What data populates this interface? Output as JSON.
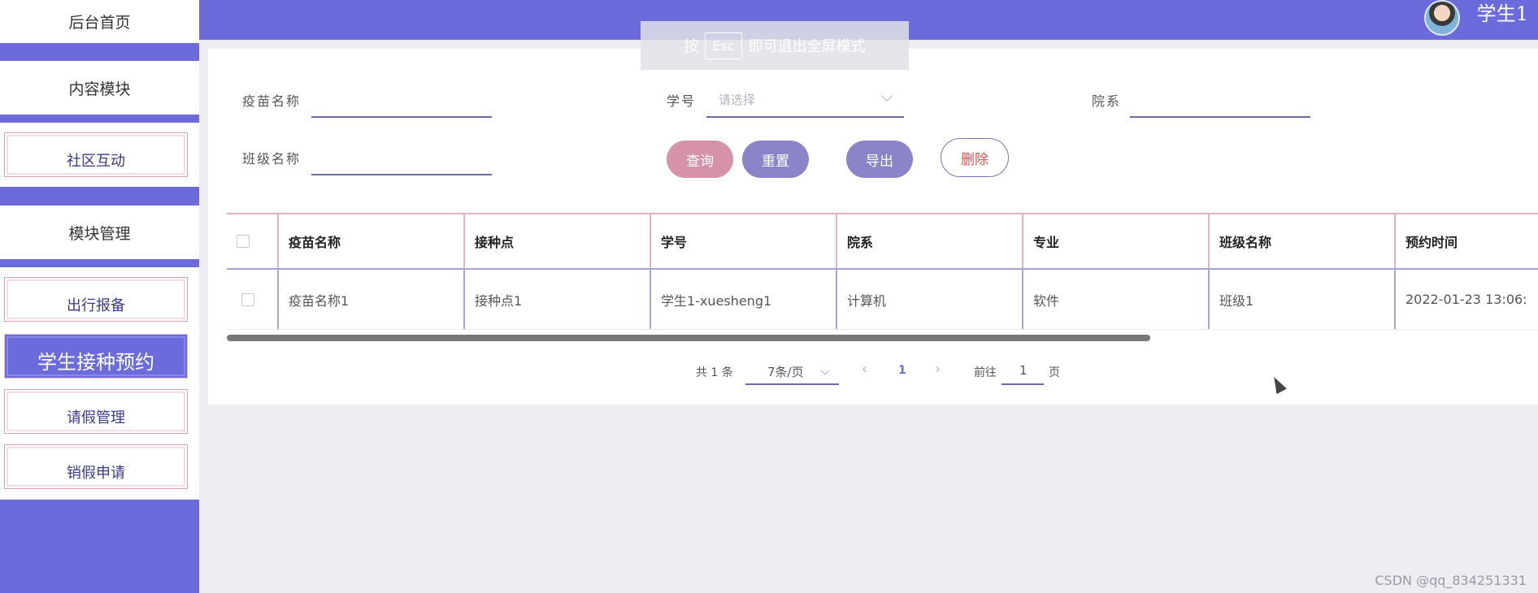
{
  "sidebar": {
    "home": "后台首页",
    "content_module": "内容模块",
    "community": "社区互动",
    "module_manage": "模块管理",
    "items": [
      "出行报备",
      "学生接种预约",
      "请假管理",
      "销假申请"
    ]
  },
  "header": {
    "username": "学生1"
  },
  "toast": {
    "prefix": "按",
    "key": "Esc",
    "suffix": "即可退出全屏模式"
  },
  "search": {
    "vaccine_label": "疫苗名称",
    "student_no_label": "学号",
    "student_no_placeholder": "请选择",
    "department_label": "院系",
    "class_label": "班级名称"
  },
  "buttons": {
    "query": "查询",
    "reset": "重置",
    "export": "导出",
    "delete": "删除"
  },
  "table": {
    "columns": [
      "疫苗名称",
      "接种点",
      "学号",
      "院系",
      "专业",
      "班级名称",
      "预约时间"
    ],
    "rows": [
      [
        "疫苗名称1",
        "接种点1",
        "学生1-xuesheng1",
        "计算机",
        "软件",
        "班级1",
        "2022-01-23 13:06:"
      ]
    ]
  },
  "pagination": {
    "total": "共 1 条",
    "page_size": "7条/页",
    "current": "1",
    "goto_label": "前往",
    "goto_value": "1",
    "page_suffix": "页"
  },
  "watermark": "CSDN @qq_834251331",
  "colors": {
    "accent": "#6b6bdc",
    "query": "#d592a8",
    "reset": "#8b84c8",
    "delete_text": "#e05050"
  }
}
